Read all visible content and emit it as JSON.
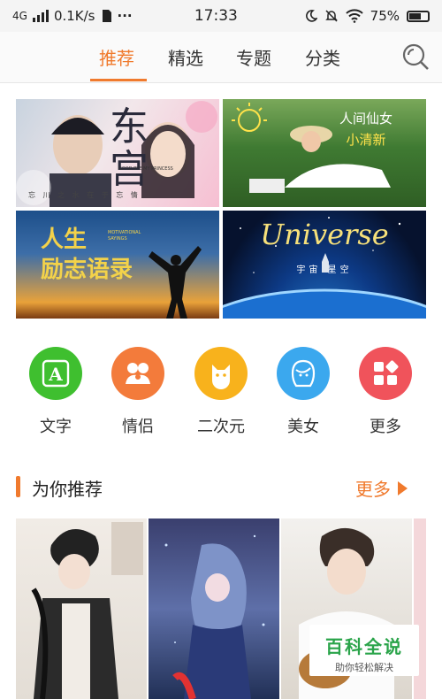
{
  "status_bar": {
    "network": "4G",
    "speed": "0.1K/s",
    "dots": "···",
    "time": "17:33",
    "battery": "75%",
    "battery_level": 0.75
  },
  "tabs": [
    {
      "label": "推荐",
      "active": true
    },
    {
      "label": "精选",
      "active": false
    },
    {
      "label": "专题",
      "active": false
    },
    {
      "label": "分类",
      "active": false
    }
  ],
  "banners": {
    "b1": {
      "title": "东宫",
      "subtitle": "忘 川 之 水    在 于 忘 情",
      "english": "GOOD BYE MY PRINCESS"
    },
    "b2": {
      "line1": "人间仙女",
      "line2": "小清新"
    },
    "b3": {
      "line1": "人生",
      "line2": "励志语录",
      "english": "MOTIVATIONAL SAYINGS"
    },
    "b4": {
      "title": "Universe",
      "subtitle": "宇宙   星空"
    }
  },
  "categories": [
    {
      "label": "文字",
      "icon": "text-a-icon",
      "color": "#3fbf2f"
    },
    {
      "label": "情侣",
      "icon": "couple-icon",
      "color": "#f37b3b"
    },
    {
      "label": "二次元",
      "icon": "cat-face-icon",
      "color": "#f8b21c"
    },
    {
      "label": "美女",
      "icon": "woman-face-icon",
      "color": "#3ba8ee"
    },
    {
      "label": "更多",
      "icon": "grid-icon",
      "color": "#f0535b"
    }
  ],
  "section": {
    "title": "为你推荐",
    "more": "更多"
  },
  "watermark": {
    "title": "百科全说",
    "subtitle": "助你轻松解决"
  },
  "colors": {
    "accent": "#f07a2d"
  }
}
